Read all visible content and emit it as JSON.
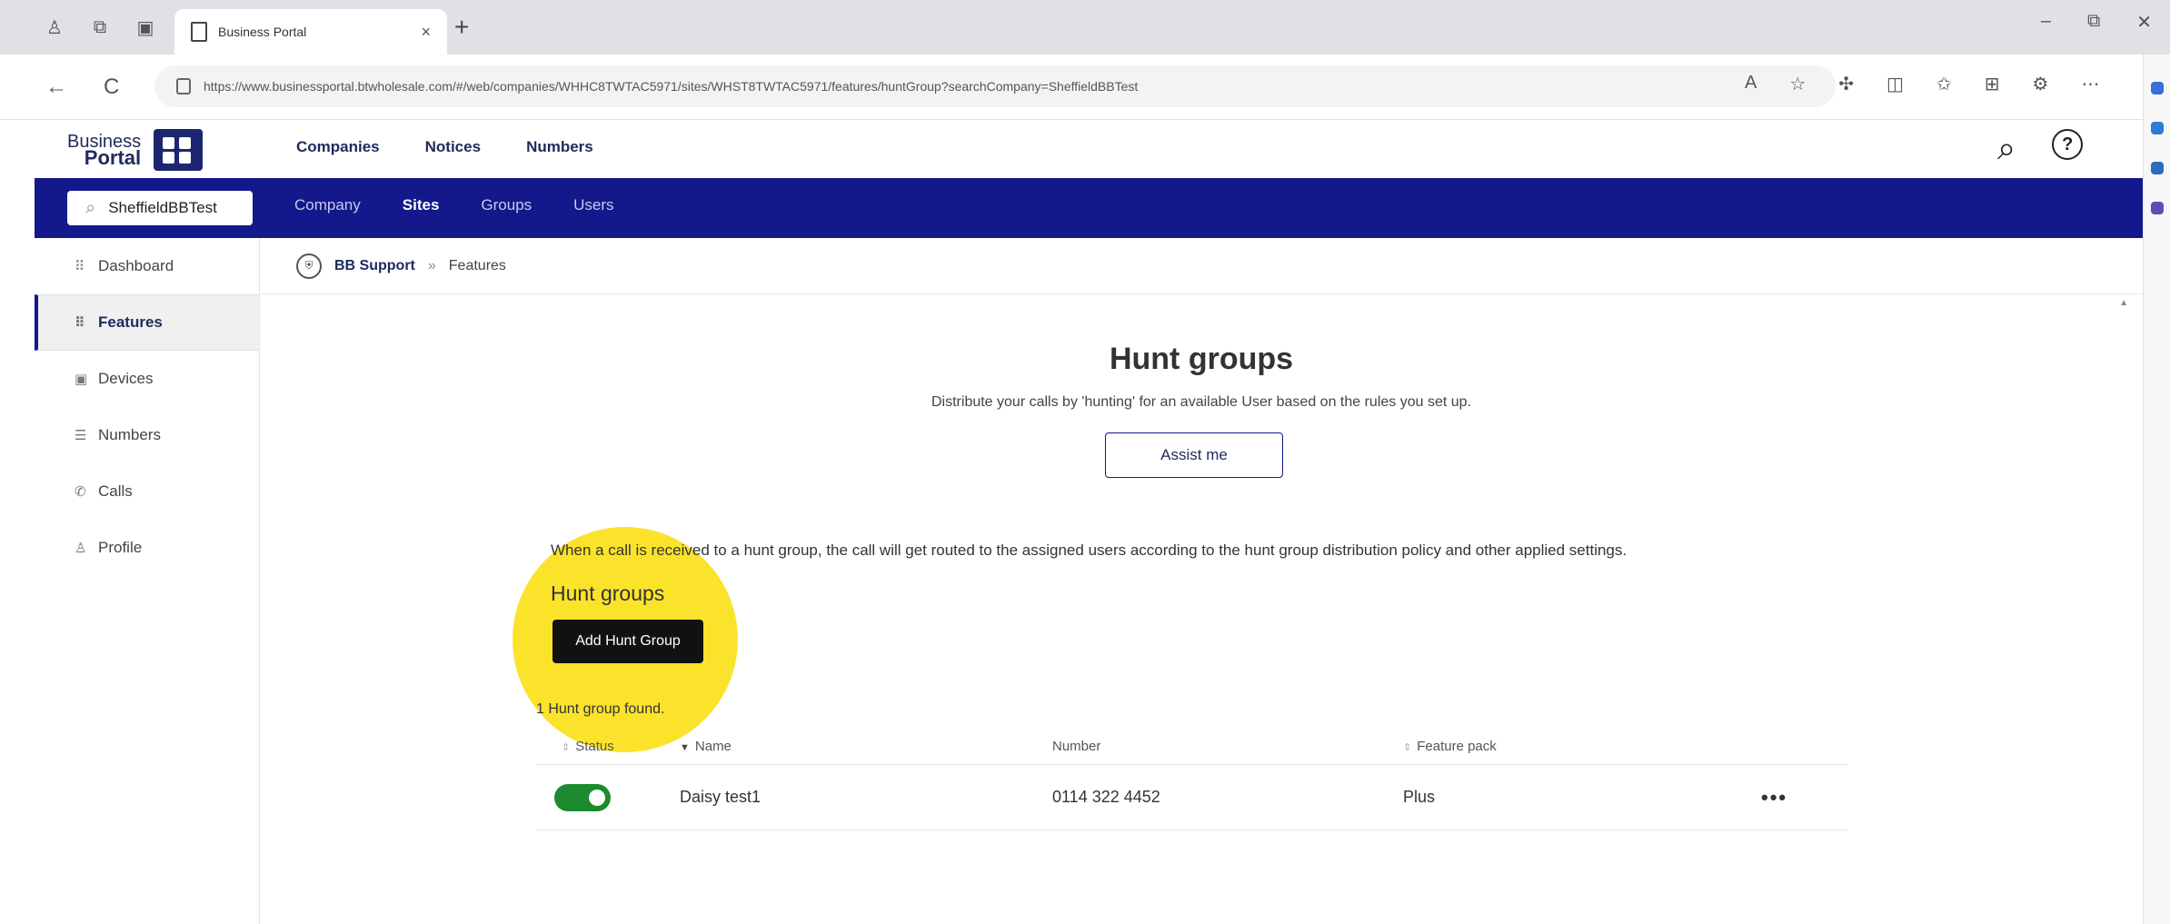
{
  "browser": {
    "tab_title": "Business Portal",
    "tab_close": "×",
    "new_tab": "+",
    "url": "https://www.businessportal.btwholesale.com/#/web/companies/WHHC8TWTAC5971/sites/WHST8TWTAC5971/features/huntGroup?searchCompany=SheffieldBBTest",
    "window_controls": [
      "–",
      "⧉",
      "✕"
    ],
    "nav_icons": [
      "←",
      "C"
    ]
  },
  "logo": {
    "line1": "Business",
    "line2": "Portal"
  },
  "top_nav": [
    "Companies",
    "Notices",
    "Numbers"
  ],
  "company_search": {
    "value": "SheffieldBBTest"
  },
  "sub_nav": {
    "items": [
      "Company",
      "Sites",
      "Groups",
      "Users"
    ],
    "active": "Sites"
  },
  "sidebar": [
    {
      "label": "Dashboard",
      "icon": "grid-icon",
      "glyph": "⠿"
    },
    {
      "label": "Features",
      "icon": "features-icon",
      "glyph": "⠿"
    },
    {
      "label": "Devices",
      "icon": "devices-icon",
      "glyph": "▣"
    },
    {
      "label": "Numbers",
      "icon": "numbers-icon",
      "glyph": "☰"
    },
    {
      "label": "Calls",
      "icon": "phone-icon",
      "glyph": "✆"
    },
    {
      "label": "Profile",
      "icon": "user-icon",
      "glyph": "♙"
    }
  ],
  "breadcrumb": {
    "parent": "BB Support",
    "separator": "»",
    "current": "Features"
  },
  "page": {
    "title": "Hunt groups",
    "subtitle": "Distribute your calls by 'hunting' for an available User based on the rules you set up.",
    "assist_button": "Assist me",
    "info": "When a call is received to a hunt group, the call will get routed to the assigned users according to the hunt group distribution policy and other applied settings.",
    "section_label": "Hunt groups",
    "add_button": "Add Hunt Group",
    "found_text": "1 Hunt group found."
  },
  "table": {
    "headers": [
      "Status",
      "Name",
      "Number",
      "Feature pack"
    ],
    "rows": [
      {
        "status_on": true,
        "name": "Daisy test1",
        "number": "0114 322 4452",
        "feature_pack": "Plus",
        "more": "•••"
      }
    ]
  },
  "colors": {
    "brand_navy": "#13198a",
    "highlight": "#fbe32b",
    "toggle_on": "#1c8a2e"
  }
}
